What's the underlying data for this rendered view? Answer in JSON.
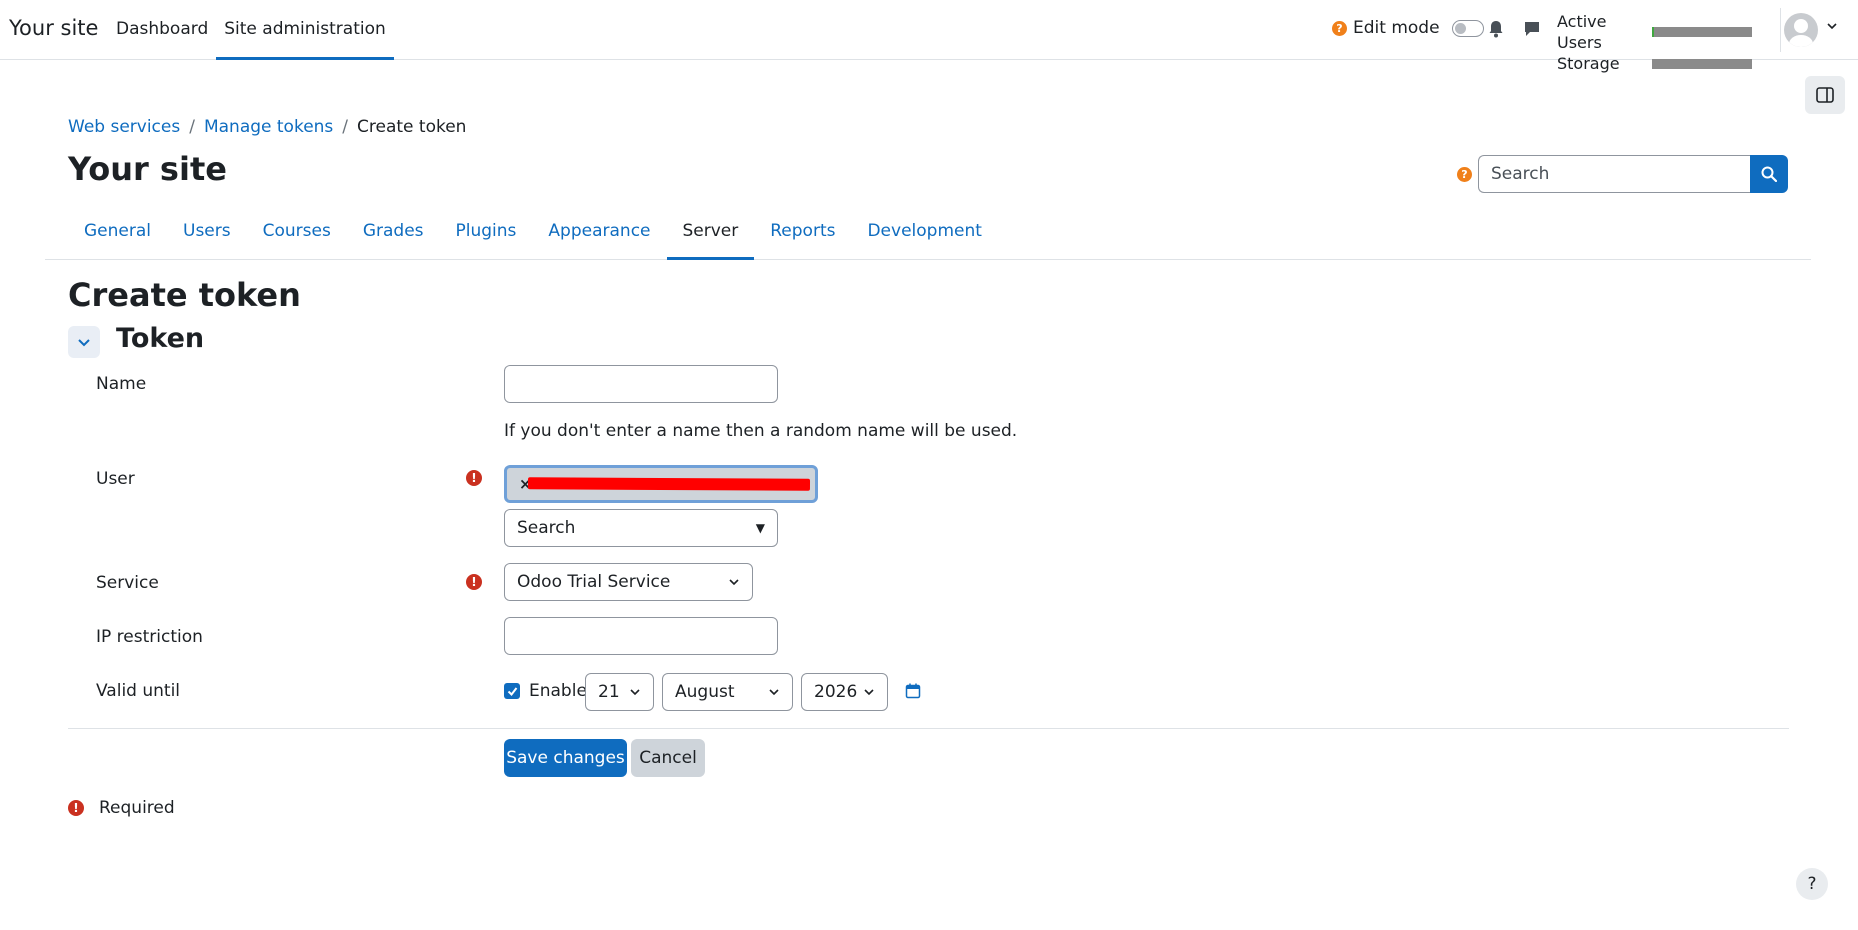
{
  "navbar": {
    "brand": "Your site",
    "links": [
      {
        "label": "Dashboard",
        "active": false
      },
      {
        "label": "Site administration",
        "active": true
      }
    ],
    "edit_mode_label": "Edit mode",
    "edit_mode_on": false,
    "usage": [
      {
        "label": "Active Users",
        "fill_fraction": 0.02
      },
      {
        "label": "Storage",
        "fill_fraction": 0.0
      }
    ]
  },
  "breadcrumb": [
    {
      "label": "Web services",
      "link": true
    },
    {
      "label": "Manage tokens",
      "link": true
    },
    {
      "label": "Create token",
      "link": false
    }
  ],
  "header": {
    "site_title": "Your site",
    "search_placeholder": "Search"
  },
  "tabs": [
    {
      "label": "General",
      "active": false
    },
    {
      "label": "Users",
      "active": false
    },
    {
      "label": "Courses",
      "active": false
    },
    {
      "label": "Grades",
      "active": false
    },
    {
      "label": "Plugins",
      "active": false
    },
    {
      "label": "Appearance",
      "active": false
    },
    {
      "label": "Server",
      "active": true
    },
    {
      "label": "Reports",
      "active": false
    },
    {
      "label": "Development",
      "active": false
    }
  ],
  "form": {
    "page_heading": "Create token",
    "section_heading": "Token",
    "name_label": "Name",
    "name_value": "",
    "name_help": "If you don't enter a name then a random name will be used.",
    "user_label": "User",
    "user_remove": "×",
    "user_search_placeholder": "Search",
    "service_label": "Service",
    "service_value": "Odoo Trial Service",
    "ip_label": "IP restriction",
    "ip_value": "",
    "valid_until_label": "Valid until",
    "enable_label": "Enable",
    "enable_checked": true,
    "day": "21",
    "month": "August",
    "year": "2026",
    "save_label": "Save changes",
    "cancel_label": "Cancel",
    "required_note": "Required",
    "required_icon": "!"
  },
  "help_fab": "?",
  "colors": {
    "primary": "#0f6cbf",
    "danger": "#ca3120",
    "warning": "#f0801a"
  }
}
